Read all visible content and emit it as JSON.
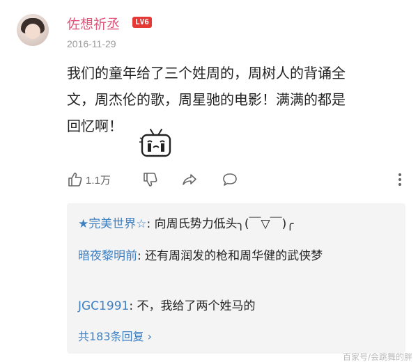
{
  "post": {
    "username": "佐想祈丞",
    "level": "LV6",
    "date": "2016-11-29",
    "comment_lines": [
      "我们的童年给了三个姓周的，周树人的背诵全",
      "文，周杰伦的歌，周星驰的电影！满满的都是",
      "回忆啊！"
    ],
    "emoji": "crying-tv-emoji"
  },
  "actions": {
    "like_count": "1.1万",
    "icons": [
      "thumbs-up-icon",
      "thumbs-down-icon",
      "share-icon",
      "comment-icon",
      "more-icon"
    ]
  },
  "replies": [
    {
      "name": "★完美世界☆",
      "sep": ": ",
      "text": "向周氏势力低头╮(￣▽￣)╭"
    },
    {
      "name": "暗夜黎明前",
      "sep": ": ",
      "text": "还有周润发的枪和周华健的武侠梦"
    },
    {
      "name": "JGC1991",
      "sep": ": ",
      "text": "不，我给了两个姓马的"
    }
  ],
  "more_replies": "共183条回复 ›",
  "watermark": "百家号/会跳舞的胖",
  "colors": {
    "username": "#e0567a",
    "link": "#3d7fc1",
    "level_badge": "#e53935"
  }
}
